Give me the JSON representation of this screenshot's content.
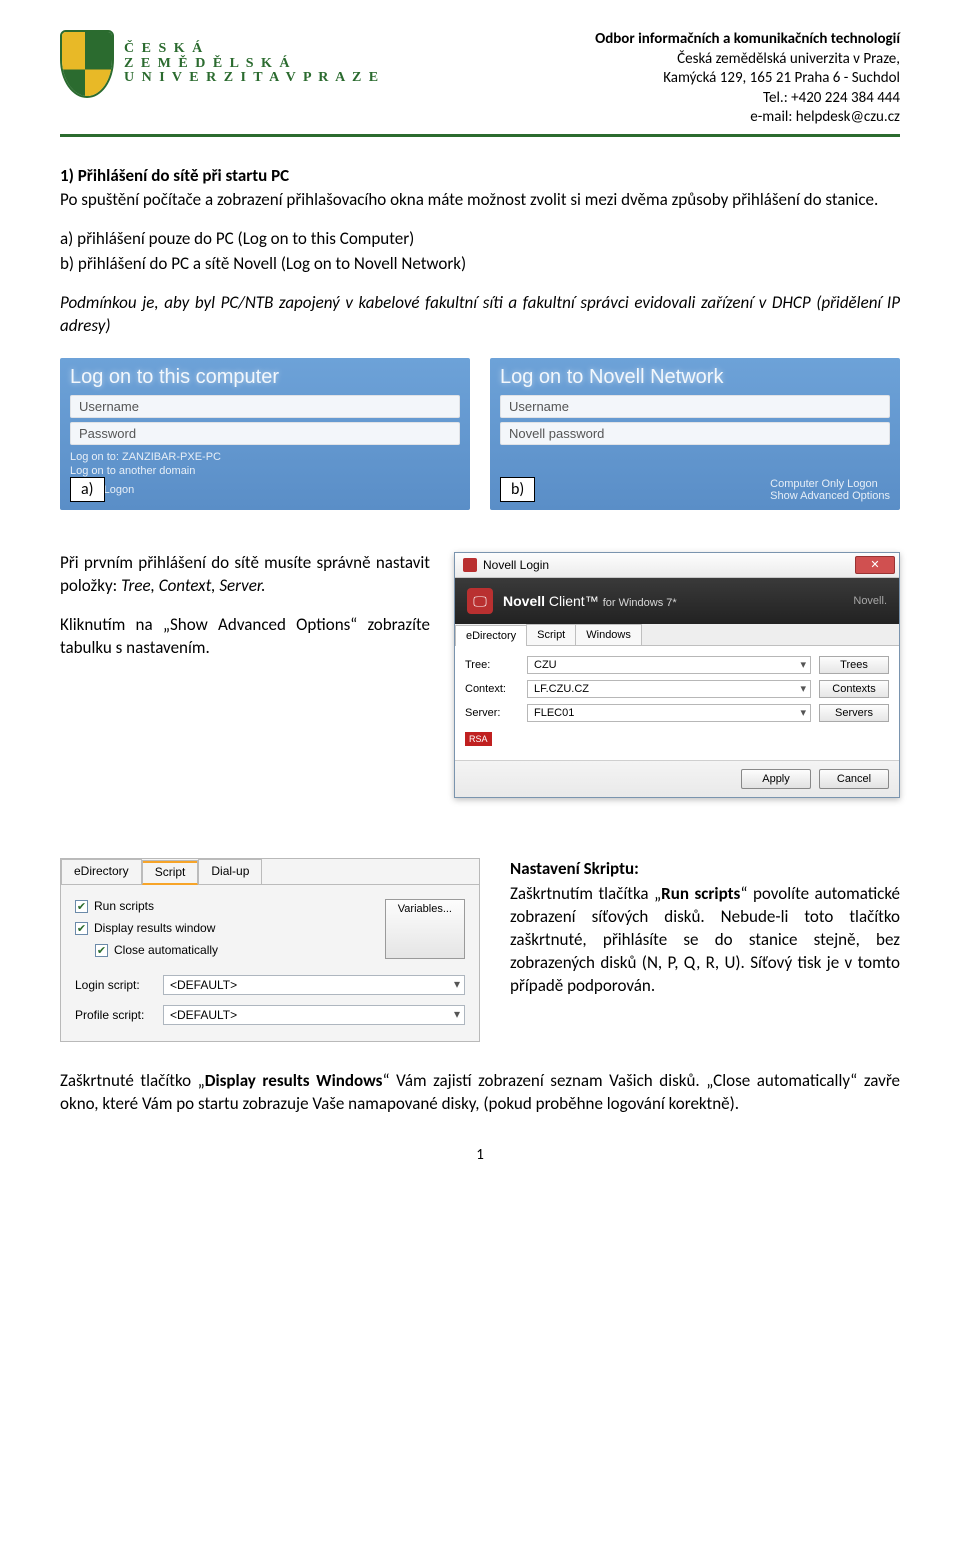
{
  "header": {
    "logo_lines": [
      "Č E S K Á",
      "Z E M Ě D Ě L S K Á",
      "U N I V E R Z I T A   V   P R A Z E"
    ],
    "dept": "Odbor informačních a komunikačních technologií",
    "uni": "Česká zemědělská univerzita v Praze,",
    "addr": "Kamýcká 129, 165 21 Praha 6 - Suchdol",
    "tel": "Tel.: +420 224 384 444",
    "email": "e-mail: helpdesk@czu.cz"
  },
  "section1_title": "1)  Přihlášení do sítě při startu PC",
  "section1_p1": "Po spuštění počítače a zobrazení přihlašovacího okna máte možnost zvolit si mezi dvěma způsoby přihlášení do stanice.",
  "section1_a": "a)   přihlášení pouze do PC (Log on to this Computer)",
  "section1_b": "b)   přihlášení do PC a sítě Novell (Log on to Novell Network)",
  "section1_cond": "Podmínkou je, aby byl PC/NTB zapojený v kabelové fakultní síti a fakultní správci evidovali zařízení v DHCP (přidělení IP adresy)",
  "panel_a": {
    "title": "Log on to this computer",
    "field_user": "Username",
    "field_pass": "Password",
    "sub1": "Log on to: ZANZIBAR-PXE-PC",
    "sub2": "Log on to another domain",
    "sub3": "Novell Logon",
    "label": "a)"
  },
  "panel_b": {
    "title": "Log on to Novell Network",
    "field_user": "Username",
    "field_pass": "Novell password",
    "right1": "Computer Only Logon",
    "right2": "Show Advanced Options",
    "label": "b)"
  },
  "para_first_login_1": "Při prvním přihlášení do sítě musíte správně nastavit položky: ",
  "para_first_login_items": "Tree, Context, Server.",
  "para_first_login_2": "Kliknutím na „Show Advanced Options“ zobrazíte tabulku s nastavením.",
  "novell": {
    "title": "Novell Login",
    "banner_main": "Novell",
    "banner_sub": "Client™",
    "banner_for": "for Windows 7*",
    "banner_right": "Novell.",
    "tabs": [
      "eDirectory",
      "Script",
      "Windows"
    ],
    "rows": {
      "tree_label": "Tree:",
      "tree_val": "CZU",
      "tree_btn": "Trees",
      "context_label": "Context:",
      "context_val": "LF.CZU.CZ",
      "context_btn": "Contexts",
      "server_label": "Server:",
      "server_val": "FLEC01",
      "server_btn": "Servers"
    },
    "rsa": "RSA",
    "apply": "Apply",
    "cancel": "Cancel"
  },
  "script_panel": {
    "tabs": [
      "eDirectory",
      "Script",
      "Dial-up"
    ],
    "cb_run": "Run scripts",
    "cb_display": "Display results window",
    "cb_close": "Close automatically",
    "variables_btn": "Variables...",
    "login_label": "Login script:",
    "login_val": "<DEFAULT>",
    "profile_label": "Profile script:",
    "profile_val": "<DEFAULT>"
  },
  "script_text": {
    "heading": "Nastavení Skriptu:",
    "p1a": "Zaškrtnutím tlačítka „",
    "p1b": "Run scripts",
    "p1c": "“ povolíte automatické zobrazení síťových disků. Nebude-li toto tlačítko zaškrtnuté, přihlásíte se do stanice stejně, bez zobrazených disků (N, P, Q, R, U). Síťový tisk je v tomto případě podporován."
  },
  "para_last_1a": "Zaškrtnuté tlačítko „",
  "para_last_1b": "Display results Windows",
  "para_last_1c": "“ Vám zajistí zobrazení seznam Vašich disků. „Close automatically“ zavře okno, které Vám po startu zobrazuje Vaše namapované disky, (pokud proběhne logování korektně).",
  "page_number": "1"
}
